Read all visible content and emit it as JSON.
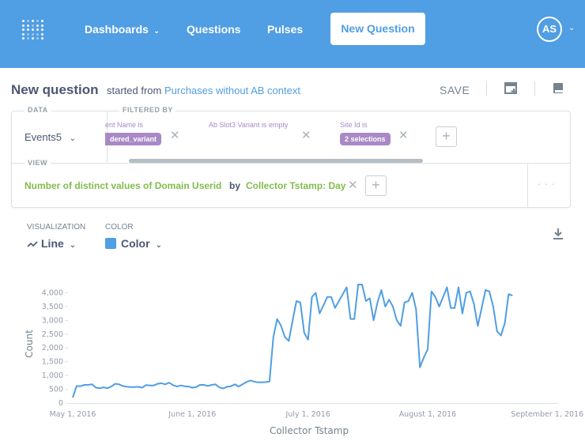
{
  "nav": {
    "logo": "metabase-logo-icon",
    "links": {
      "dashboards": "Dashboards",
      "questions": "Questions",
      "pulses": "Pulses"
    },
    "new_question": "New Question",
    "avatar": "AS",
    "accent": "#509ee3"
  },
  "header": {
    "title": "New question",
    "started_from": "started from",
    "source_link": "Purchases without AB context",
    "save": "SAVE"
  },
  "query": {
    "data_label": "DATA",
    "filtered_by_label": "FILTERED BY",
    "view_label": "VIEW",
    "source": "Events5",
    "filters": [
      {
        "label": "ent Name is",
        "pill": "dered_variant"
      },
      {
        "label": "Ab Slot3 Variant is empty",
        "pill": ""
      },
      {
        "label": "Site Id is",
        "pill": "2 selections"
      }
    ],
    "aggregation": "Number of distinct values of Domain Userid",
    "by": "by",
    "breakout": "Collector Tstamp: Day"
  },
  "viz": {
    "visualization_label": "VISUALIZATION",
    "visualization_value": "Line",
    "color_label": "COLOR",
    "color_value": "Color",
    "series_color": "#509ee3"
  },
  "chart_data": {
    "type": "line",
    "xlabel": "Collector Tstamp",
    "ylabel": "Count",
    "ylim": [
      0,
      4300
    ],
    "yticks": [
      "0",
      "500",
      "1,000",
      "1,500",
      "2,000",
      "2,500",
      "3,000",
      "3,500",
      "4,000"
    ],
    "x_range": [
      "2016-05-01",
      "2016-09-03"
    ],
    "xticks": [
      {
        "date": "2016-05-01",
        "label": "May 1, 2016"
      },
      {
        "date": "2016-06-01",
        "label": "June 1, 2016"
      },
      {
        "date": "2016-07-01",
        "label": "July 1, 2016"
      },
      {
        "date": "2016-08-01",
        "label": "August 1, 2016"
      },
      {
        "date": "2016-09-01",
        "label": "September 1, 2016"
      }
    ],
    "series": [
      {
        "color": "#509ee3",
        "start_date": "2016-05-01",
        "values": [
          200,
          620,
          610,
          660,
          660,
          680,
          560,
          540,
          570,
          540,
          600,
          700,
          680,
          620,
          590,
          580,
          580,
          590,
          560,
          650,
          640,
          640,
          700,
          720,
          680,
          740,
          650,
          600,
          640,
          610,
          600,
          560,
          580,
          660,
          660,
          620,
          660,
          680,
          570,
          530,
          590,
          610,
          680,
          600,
          680,
          760,
          820,
          780,
          750,
          750,
          760,
          780,
          2400,
          3050,
          2800,
          2400,
          2250,
          3000,
          3700,
          3650,
          2550,
          2300,
          3850,
          4000,
          3250,
          3550,
          3850,
          3850,
          3450,
          3700,
          3950,
          4200,
          3050,
          3050,
          4300,
          4300,
          3700,
          3800,
          3000,
          3650,
          4100,
          3500,
          3750,
          3500,
          3000,
          2800,
          3650,
          3700,
          4000,
          3400,
          1300,
          1650,
          1950,
          4050,
          3850,
          3500,
          3850,
          4200,
          3450,
          3450,
          4200,
          3250,
          4000,
          4050,
          3600,
          2800,
          3450,
          4100,
          4050,
          3500,
          2600,
          2450,
          2900,
          3950,
          3900
        ]
      }
    ]
  }
}
